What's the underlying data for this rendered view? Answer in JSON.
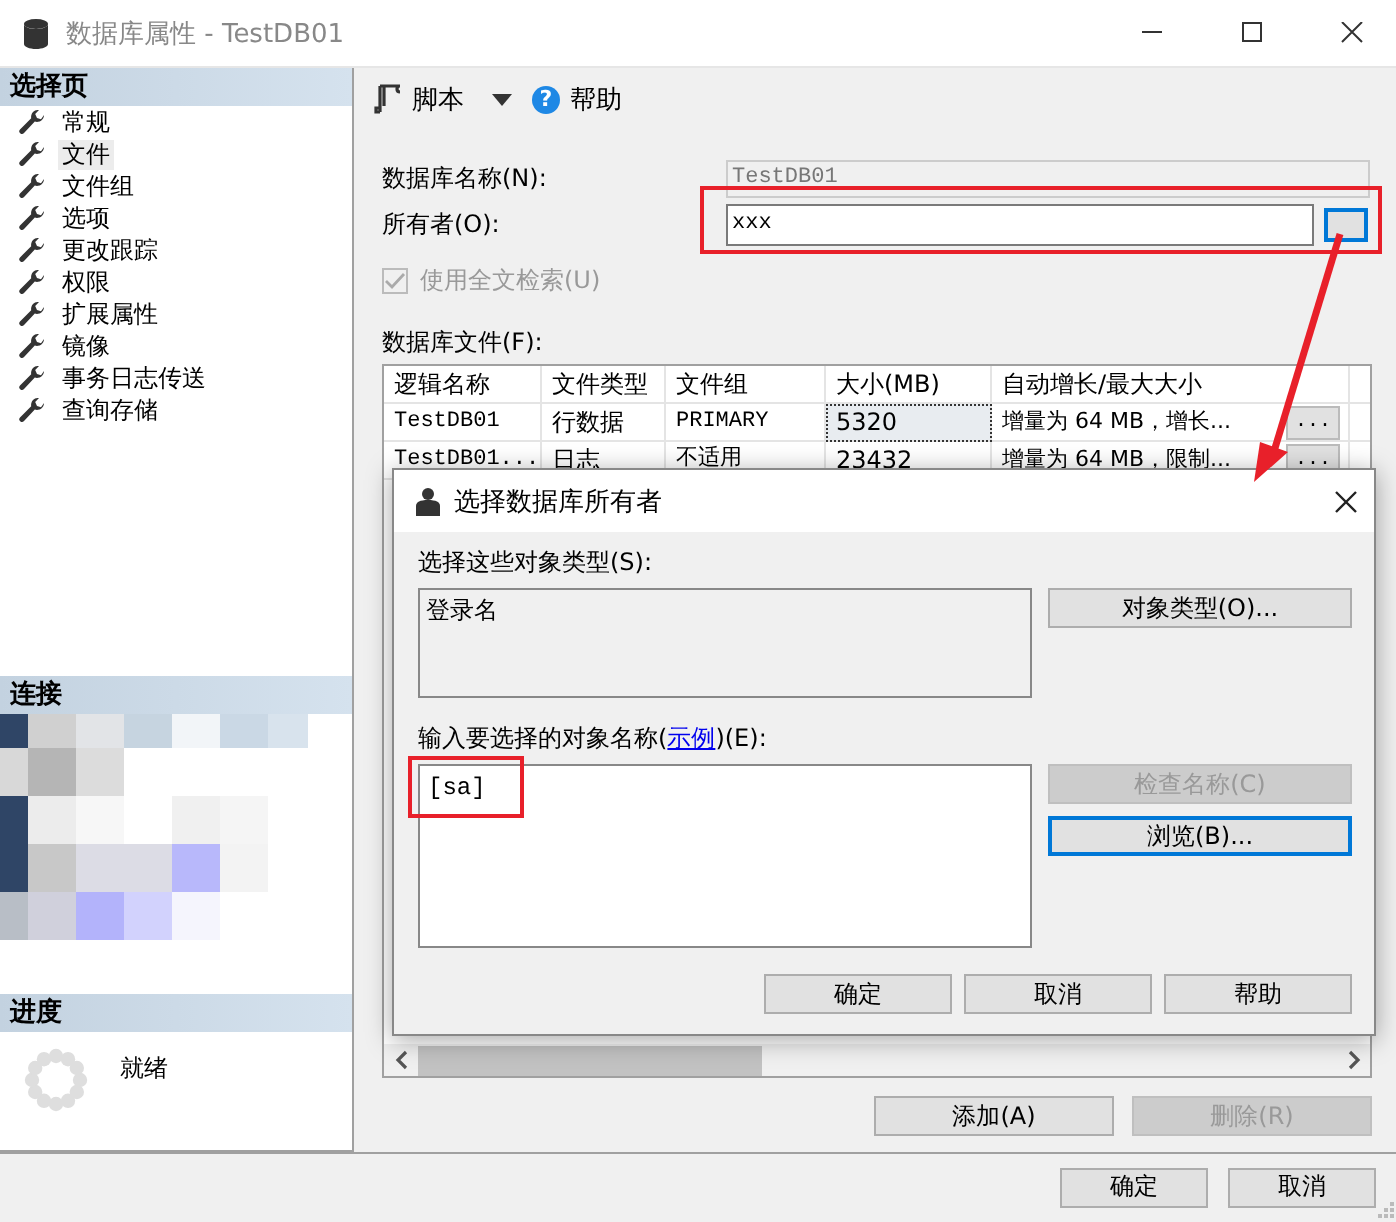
{
  "window": {
    "title": "数据库属性 - TestDB01"
  },
  "sidebar": {
    "title": "选择页",
    "items": [
      {
        "label": "常规",
        "selected": false
      },
      {
        "label": "文件",
        "selected": true
      },
      {
        "label": "文件组",
        "selected": false
      },
      {
        "label": "选项",
        "selected": false
      },
      {
        "label": "更改跟踪",
        "selected": false
      },
      {
        "label": "权限",
        "selected": false
      },
      {
        "label": "扩展属性",
        "selected": false
      },
      {
        "label": "镜像",
        "selected": false
      },
      {
        "label": "事务日志传送",
        "selected": false
      },
      {
        "label": "查询存储",
        "selected": false
      }
    ]
  },
  "connection": {
    "title": "连接"
  },
  "progress": {
    "title": "进度",
    "status": "就绪"
  },
  "toolbar": [
    {
      "kind": "script",
      "label": "脚本"
    },
    {
      "kind": "help",
      "icon": "?",
      "label": "帮助"
    }
  ],
  "form": {
    "name_label": "数据库名称(N):",
    "name_value": "TestDB01",
    "owner_label": "所有者(O):",
    "owner_value": "xxx",
    "fulltext": {
      "label": "使用全文检索(U)",
      "checked": true,
      "disabled": true
    },
    "files_label": "数据库文件(F):"
  },
  "table": {
    "columns": [
      "逻辑名称",
      "文件类型",
      "文件组",
      "大小(MB)",
      "自动增长/最大大小"
    ],
    "rows": [
      {
        "cells": [
          "TestDB01",
          "行数据",
          "PRIMARY",
          "5320",
          "增量为 64 MB，增长..."
        ],
        "button": "...",
        "size_focused": true
      },
      {
        "cells": [
          "TestDB01...",
          "日志",
          "不适用",
          "23432",
          "增量为 64 MB，限制..."
        ],
        "button": "...",
        "size_focused": false
      }
    ]
  },
  "table_buttons": [
    {
      "label": "添加(A)",
      "disabled": false
    },
    {
      "label": "删除(R)",
      "disabled": true
    }
  ],
  "footer_buttons": [
    "确定",
    "取消"
  ],
  "dialog": {
    "title": "选择数据库所有者",
    "types_label": "选择这些对象类型(S):",
    "types_value": "登录名",
    "names_label_before": "输入要选择的对象名称(",
    "names_link": "示例",
    "names_label_after": ")(E):",
    "names_value": "[sa]",
    "side_buttons": [
      {
        "label": "对象类型(O)...",
        "disabled": false,
        "focused": false
      },
      {
        "label": "检查名称(C)",
        "disabled": true,
        "focused": false
      },
      {
        "label": "浏览(B)...",
        "disabled": false,
        "focused": true
      }
    ],
    "footer_buttons": [
      "确定",
      "取消",
      "帮助"
    ]
  }
}
